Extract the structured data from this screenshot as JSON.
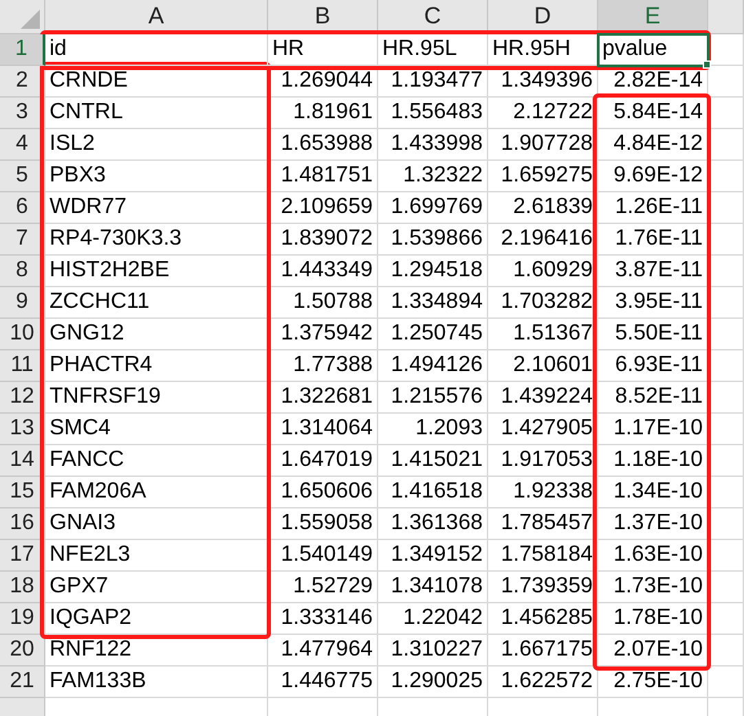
{
  "column_headers": [
    {
      "label": "A",
      "selected": false
    },
    {
      "label": "B",
      "selected": false
    },
    {
      "label": "C",
      "selected": false
    },
    {
      "label": "D",
      "selected": false
    },
    {
      "label": "E",
      "selected": true
    },
    {
      "selected": false
    }
  ],
  "rows": [
    {
      "number": "1",
      "selected": true,
      "cells": [
        "id",
        "HR",
        "HR.95L",
        "HR.95H",
        "pvalue"
      ]
    },
    {
      "number": "2",
      "selected": false,
      "cells": [
        "CRNDE",
        "1.269044",
        "1.193477",
        "1.349396",
        "2.82E-14"
      ]
    },
    {
      "number": "3",
      "selected": false,
      "cells": [
        "CNTRL",
        "1.81961",
        "1.556483",
        "2.12722",
        "5.84E-14"
      ]
    },
    {
      "number": "4",
      "selected": false,
      "cells": [
        "ISL2",
        "1.653988",
        "1.433998",
        "1.907728",
        "4.84E-12"
      ]
    },
    {
      "number": "5",
      "selected": false,
      "cells": [
        "PBX3",
        "1.481751",
        "1.32322",
        "1.659275",
        "9.69E-12"
      ]
    },
    {
      "number": "6",
      "selected": false,
      "cells": [
        "WDR77",
        "2.109659",
        "1.699769",
        "2.61839",
        "1.26E-11"
      ]
    },
    {
      "number": "7",
      "selected": false,
      "cells": [
        "RP4-730K3.3",
        "1.839072",
        "1.539866",
        "2.196416",
        "1.76E-11"
      ]
    },
    {
      "number": "8",
      "selected": false,
      "cells": [
        "HIST2H2BE",
        "1.443349",
        "1.294518",
        "1.60929",
        "3.87E-11"
      ]
    },
    {
      "number": "9",
      "selected": false,
      "cells": [
        "ZCCHC11",
        "1.50788",
        "1.334894",
        "1.703282",
        "3.95E-11"
      ]
    },
    {
      "number": "10",
      "selected": false,
      "cells": [
        "GNG12",
        "1.375942",
        "1.250745",
        "1.51367",
        "5.50E-11"
      ]
    },
    {
      "number": "11",
      "selected": false,
      "cells": [
        "PHACTR4",
        "1.77388",
        "1.494126",
        "2.10601",
        "6.93E-11"
      ]
    },
    {
      "number": "12",
      "selected": false,
      "cells": [
        "TNFRSF19",
        "1.322681",
        "1.215576",
        "1.439224",
        "8.52E-11"
      ]
    },
    {
      "number": "13",
      "selected": false,
      "cells": [
        "SMC4",
        "1.314064",
        "1.2093",
        "1.427905",
        "1.17E-10"
      ]
    },
    {
      "number": "14",
      "selected": false,
      "cells": [
        "FANCC",
        "1.647019",
        "1.415021",
        "1.917053",
        "1.18E-10"
      ]
    },
    {
      "number": "15",
      "selected": false,
      "cells": [
        "FAM206A",
        "1.650606",
        "1.416518",
        "1.92338",
        "1.34E-10"
      ]
    },
    {
      "number": "16",
      "selected": false,
      "cells": [
        "GNAI3",
        "1.559058",
        "1.361368",
        "1.785457",
        "1.37E-10"
      ]
    },
    {
      "number": "17",
      "selected": false,
      "cells": [
        "NFE2L3",
        "1.540149",
        "1.349152",
        "1.758184",
        "1.63E-10"
      ]
    },
    {
      "number": "18",
      "selected": false,
      "cells": [
        "GPX7",
        "1.52729",
        "1.341078",
        "1.739359",
        "1.73E-10"
      ]
    },
    {
      "number": "19",
      "selected": false,
      "cells": [
        "IQGAP2",
        "1.333146",
        "1.22042",
        "1.456285",
        "1.78E-10"
      ]
    },
    {
      "number": "20",
      "selected": false,
      "cells": [
        "RNF122",
        "1.477964",
        "1.310227",
        "1.667175",
        "2.07E-10"
      ]
    },
    {
      "number": "21",
      "selected": false,
      "cells": [
        "FAM133B",
        "1.446775",
        "1.290025",
        "1.622572",
        "2.75E-10"
      ]
    }
  ],
  "highlights": [
    {
      "kind": "header"
    },
    {
      "kind": "ids"
    },
    {
      "kind": "pvalues"
    }
  ]
}
